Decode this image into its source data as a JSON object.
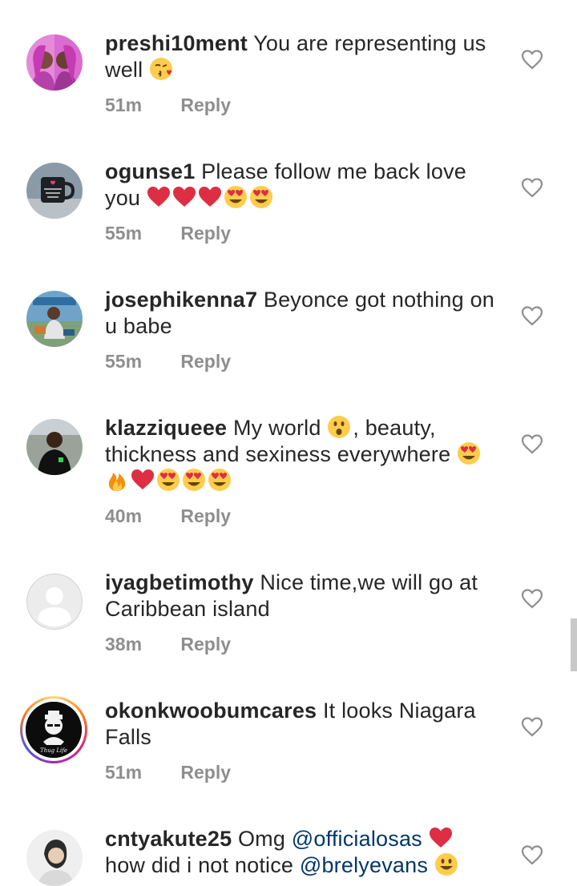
{
  "comments": [
    {
      "username": "preshi10ment",
      "text": "You are representing us well",
      "time": "51m",
      "reply_label": "Reply",
      "emojis": [
        "kissing-heart-emoji"
      ]
    },
    {
      "username": "ogunse1",
      "text": "Please follow me back love you",
      "time": "55m",
      "reply_label": "Reply",
      "emojis": [
        "red-heart-emoji",
        "red-heart-emoji",
        "red-heart-emoji",
        "heart-eyes-emoji",
        "heart-eyes-emoji"
      ]
    },
    {
      "username": "josephikenna7",
      "text": "Beyonce got nothing on u babe",
      "time": "55m",
      "reply_label": "Reply"
    },
    {
      "username": "klazziqueee",
      "text_before": "My world",
      "text_after": ", beauty, thickness and sexiness everywhere",
      "time": "40m",
      "reply_label": "Reply",
      "emojis": [
        "astonished-face-emoji",
        "heart-eyes-emoji",
        "fire-emoji",
        "red-heart-emoji",
        "heart-eyes-emoji",
        "heart-eyes-emoji",
        "heart-eyes-emoji"
      ]
    },
    {
      "username": "iyagbetimothy",
      "text": "Nice time,we will go at Caribbean island",
      "time": "38m",
      "reply_label": "Reply"
    },
    {
      "username": "okonkwoobumcares",
      "text": "It looks Niagara Falls",
      "time": "51m",
      "reply_label": "Reply",
      "avatar_text": "Thug Life"
    },
    {
      "username": "cntyakute25",
      "text_before": "Omg",
      "mention_1": "@officialosas",
      "line2_text": "how did i not notice",
      "mention_2": "@brelyevans",
      "emojis": [
        "red-heart-emoji",
        "grinning-face-emoji"
      ]
    }
  ],
  "icons": {
    "like": "heart-outline-icon"
  },
  "colors": {
    "text": "#262626",
    "secondary": "#8e8e8e",
    "mention": "#00376b",
    "background": "#ffffff"
  }
}
